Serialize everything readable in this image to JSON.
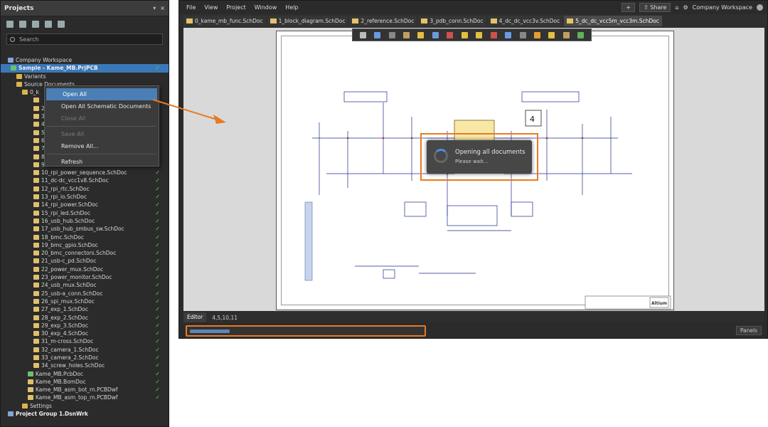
{
  "projects_panel": {
    "title": "Projects",
    "pin_glyph": "▾",
    "close_glyph": "×",
    "search_placeholder": "Search",
    "workspace": "Company Workspace",
    "tree": [
      {
        "label": "Company Workspace",
        "indent": 10,
        "icon": "grp",
        "bold": false,
        "ok": false
      },
      {
        "label": "Sample - Kame_MB.PrjPCB",
        "indent": 14,
        "icon": "pcb",
        "bold": true,
        "ok": true,
        "selected": true
      },
      {
        "label": "Variants",
        "indent": 22,
        "icon": "folder",
        "ok": false
      },
      {
        "label": "Source Documents",
        "indent": 22,
        "icon": "folder",
        "ok": false
      },
      {
        "label": "0_k",
        "indent": 30,
        "icon": "folder",
        "ok": false
      },
      {
        "label": "",
        "indent": 46,
        "icon": "doc",
        "ok": true
      },
      {
        "label": "2",
        "indent": 46,
        "icon": "doc",
        "ok": true
      },
      {
        "label": "3",
        "indent": 46,
        "icon": "doc",
        "ok": true
      },
      {
        "label": "4",
        "indent": 46,
        "icon": "doc",
        "ok": true
      },
      {
        "label": "5",
        "indent": 46,
        "icon": "doc",
        "ok": true
      },
      {
        "label": "6",
        "indent": 46,
        "icon": "doc",
        "ok": true
      },
      {
        "label": "7",
        "indent": 46,
        "icon": "doc",
        "ok": true
      },
      {
        "label": "8",
        "indent": 46,
        "icon": "doc",
        "ok": true
      },
      {
        "label": "9",
        "indent": 46,
        "icon": "doc",
        "ok": true
      },
      {
        "label": "10_rpi_power_sequence.SchDoc",
        "indent": 46,
        "icon": "doc",
        "ok": true
      },
      {
        "label": "11_dc-dc_vcc1v8.SchDoc",
        "indent": 46,
        "icon": "doc",
        "ok": true
      },
      {
        "label": "12_rpi_rtc.SchDoc",
        "indent": 46,
        "icon": "doc",
        "ok": true
      },
      {
        "label": "13_rpi_io.SchDoc",
        "indent": 46,
        "icon": "doc",
        "ok": true
      },
      {
        "label": "14_rpi_power.SchDoc",
        "indent": 46,
        "icon": "doc",
        "ok": true
      },
      {
        "label": "15_rpi_led.SchDoc",
        "indent": 46,
        "icon": "doc",
        "ok": true
      },
      {
        "label": "16_usb_hub.SchDoc",
        "indent": 46,
        "icon": "doc",
        "ok": true
      },
      {
        "label": "17_usb_hub_smbus_sw.SchDoc",
        "indent": 46,
        "icon": "doc",
        "ok": true
      },
      {
        "label": "18_bmc.SchDoc",
        "indent": 46,
        "icon": "doc",
        "ok": true
      },
      {
        "label": "19_bmc_gpio.SchDoc",
        "indent": 46,
        "icon": "doc",
        "ok": true
      },
      {
        "label": "20_bmc_connectors.SchDoc",
        "indent": 46,
        "icon": "doc",
        "ok": true
      },
      {
        "label": "21_usb-c_pd.SchDoc",
        "indent": 46,
        "icon": "doc",
        "ok": true
      },
      {
        "label": "22_power_mux.SchDoc",
        "indent": 46,
        "icon": "doc",
        "ok": true
      },
      {
        "label": "23_power_monitor.SchDoc",
        "indent": 46,
        "icon": "doc",
        "ok": true
      },
      {
        "label": "24_usb_mux.SchDoc",
        "indent": 46,
        "icon": "doc",
        "ok": true
      },
      {
        "label": "25_usb-a_conn.SchDoc",
        "indent": 46,
        "icon": "doc",
        "ok": true
      },
      {
        "label": "26_spi_mux.SchDoc",
        "indent": 46,
        "icon": "doc",
        "ok": true
      },
      {
        "label": "27_exp_1.SchDoc",
        "indent": 46,
        "icon": "doc",
        "ok": true
      },
      {
        "label": "28_exp_2.SchDoc",
        "indent": 46,
        "icon": "doc",
        "ok": true
      },
      {
        "label": "29_exp_3.SchDoc",
        "indent": 46,
        "icon": "doc",
        "ok": true
      },
      {
        "label": "30_exp_4.SchDoc",
        "indent": 46,
        "icon": "doc",
        "ok": true
      },
      {
        "label": "31_m-cross.SchDoc",
        "indent": 46,
        "icon": "doc",
        "ok": true
      },
      {
        "label": "32_camera_1.SchDoc",
        "indent": 46,
        "icon": "doc",
        "ok": true
      },
      {
        "label": "33_camera_2.SchDoc",
        "indent": 46,
        "icon": "doc",
        "ok": true
      },
      {
        "label": "34_screw_holes.SchDoc",
        "indent": 46,
        "icon": "doc",
        "ok": true
      },
      {
        "label": "Kame_MB.PcbDoc",
        "indent": 38,
        "icon": "pcb",
        "ok": true
      },
      {
        "label": "Kame_MB.BomDoc",
        "indent": 38,
        "icon": "doc",
        "ok": true
      },
      {
        "label": "Kame_MB_asm_bot_rn.PCBDwf",
        "indent": 38,
        "icon": "doc",
        "ok": true
      },
      {
        "label": "Kame_MB_asm_top_rn.PCBDwf",
        "indent": 38,
        "icon": "doc",
        "ok": true
      },
      {
        "label": "Settings",
        "indent": 30,
        "icon": "folder",
        "ok": false
      },
      {
        "label": "Project Group 1.DsnWrk",
        "indent": 10,
        "icon": "grp",
        "bold": true,
        "ok": false
      }
    ]
  },
  "context_menu": {
    "items": [
      {
        "label": "Open All",
        "state": "hl"
      },
      {
        "label": "Open All Schematic Documents",
        "state": "normal"
      },
      {
        "label": "Close All",
        "state": "dis"
      },
      {
        "label": "sep"
      },
      {
        "label": "Save All",
        "state": "dis"
      },
      {
        "label": "Remove All...",
        "state": "normal"
      },
      {
        "label": "sep"
      },
      {
        "label": "Refresh",
        "state": "normal"
      }
    ]
  },
  "app": {
    "menu": [
      "File",
      "View",
      "Project",
      "Window",
      "Help"
    ],
    "share_label": "Share",
    "workspace_label": "Company Workspace",
    "tabs": [
      "0_kame_mb_func.SchDoc",
      "1_block_diagram.SchDoc",
      "2_reference.SchDoc",
      "3_pdb_conn.SchDoc",
      "4_dc_dc_vcc3v.SchDoc",
      "5_dc_dc_vcc5m_vcc3m.SchDoc"
    ],
    "active_tab": 5,
    "sheet_number_label": "4",
    "busy_title": "Opening all documents",
    "busy_sub": "Please wait...",
    "status_editor": "Editor",
    "status_coords": "4,5,10,11",
    "progress_fraction": 0.17,
    "panels_label": "Panels",
    "title_block_brand": "Altium"
  },
  "colors": {
    "highlight": "#e87a22",
    "selection": "#3a78b8",
    "ok": "#5fcf5f"
  }
}
